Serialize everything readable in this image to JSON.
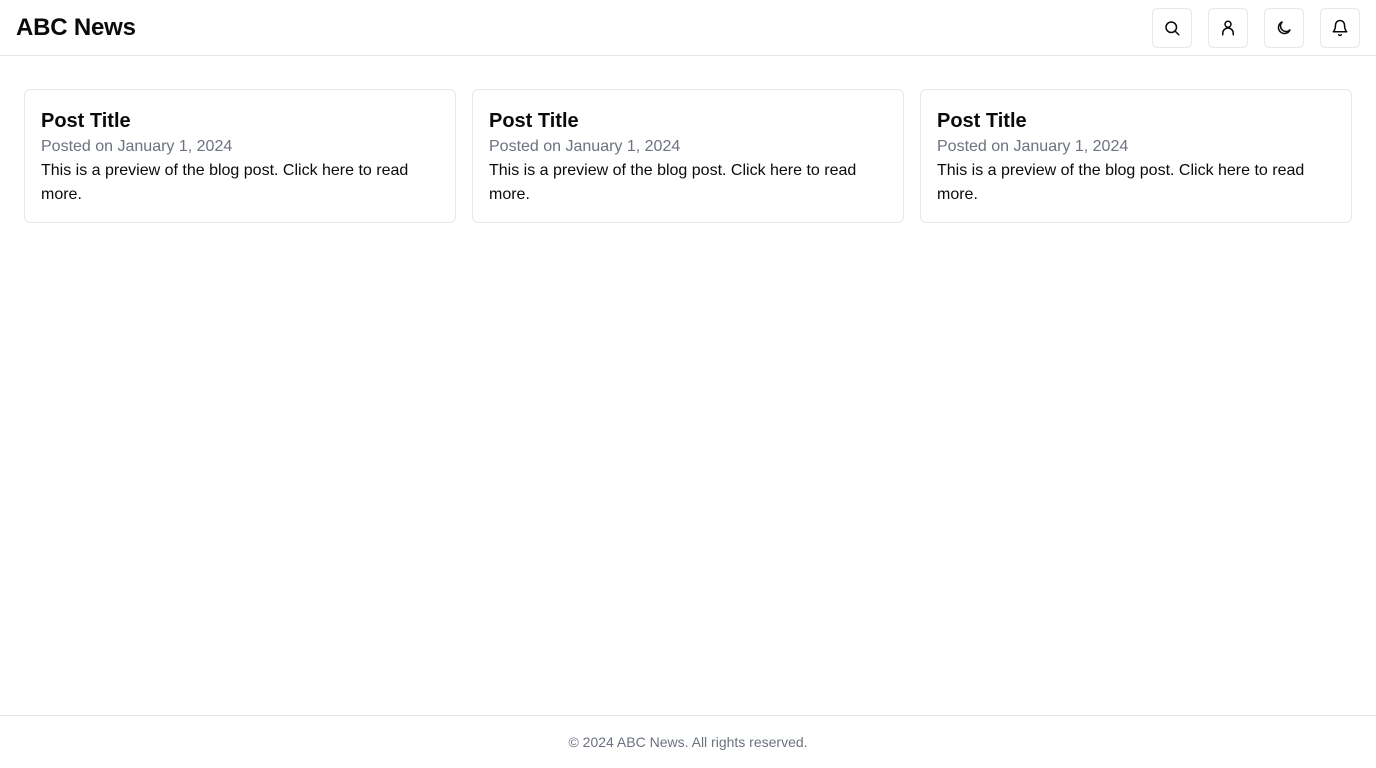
{
  "header": {
    "site_title": "ABC News",
    "buttons": [
      {
        "icon": "search-icon"
      },
      {
        "icon": "user-icon"
      },
      {
        "icon": "moon-icon"
      },
      {
        "icon": "bell-icon"
      }
    ]
  },
  "posts": [
    {
      "title": "Post Title",
      "date": "Posted on January 1, 2024",
      "preview": "This is a preview of the blog post. Click here to read more."
    },
    {
      "title": "Post Title",
      "date": "Posted on January 1, 2024",
      "preview": "This is a preview of the blog post. Click here to read more."
    },
    {
      "title": "Post Title",
      "date": "Posted on January 1, 2024",
      "preview": "This is a preview of the blog post. Click here to read more."
    }
  ],
  "footer": {
    "text": "© 2024 ABC News. All rights reserved."
  },
  "colors": {
    "text": "#0a0a0a",
    "muted": "#6b7280",
    "border": "#e5e7eb",
    "background": "#ffffff"
  }
}
